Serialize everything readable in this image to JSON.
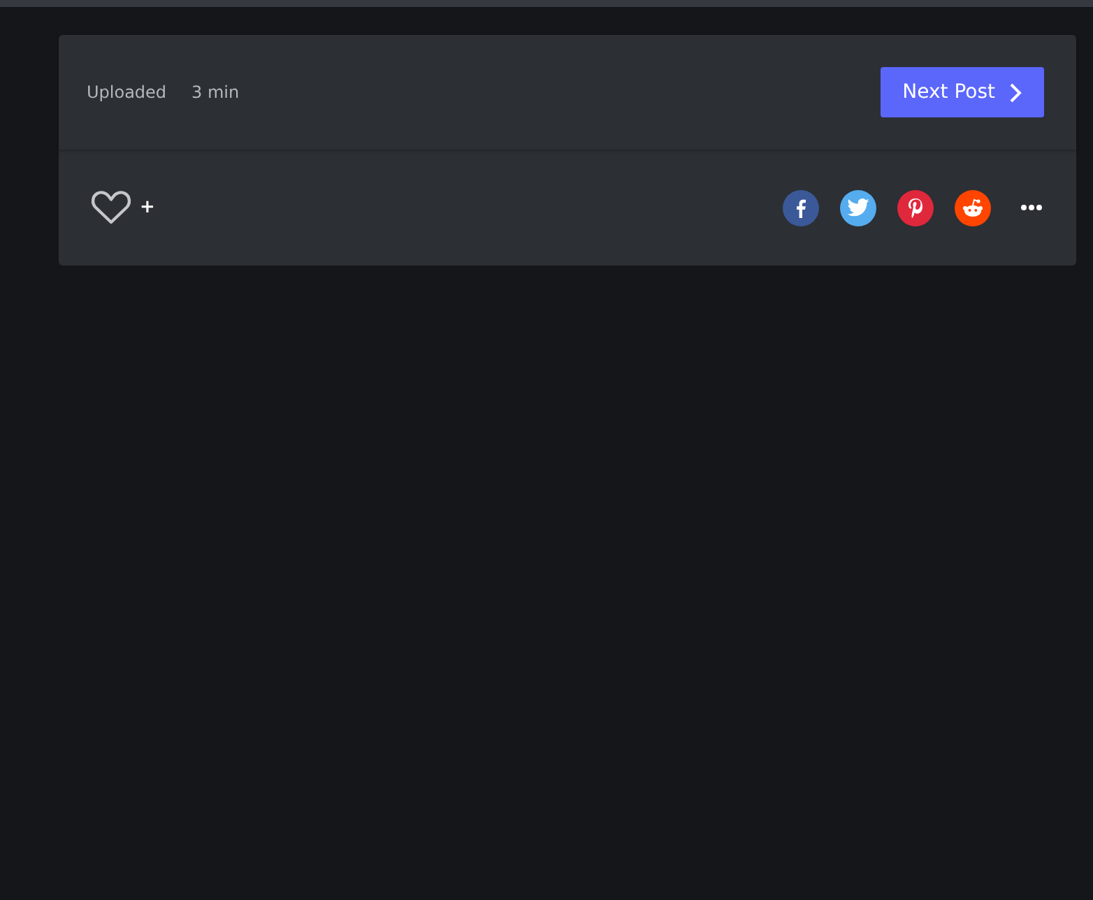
{
  "meta": {
    "label": "Uploaded",
    "time": "3 min"
  },
  "next_button": {
    "label": "Next Post"
  },
  "like": {
    "plus": "+"
  },
  "share": [
    {
      "kind": "facebook",
      "color": "#3b5998"
    },
    {
      "kind": "twitter",
      "color": "#55acee"
    },
    {
      "kind": "pinterest",
      "color": "#e0283c"
    },
    {
      "kind": "reddit",
      "color": "#ff4500"
    }
  ]
}
